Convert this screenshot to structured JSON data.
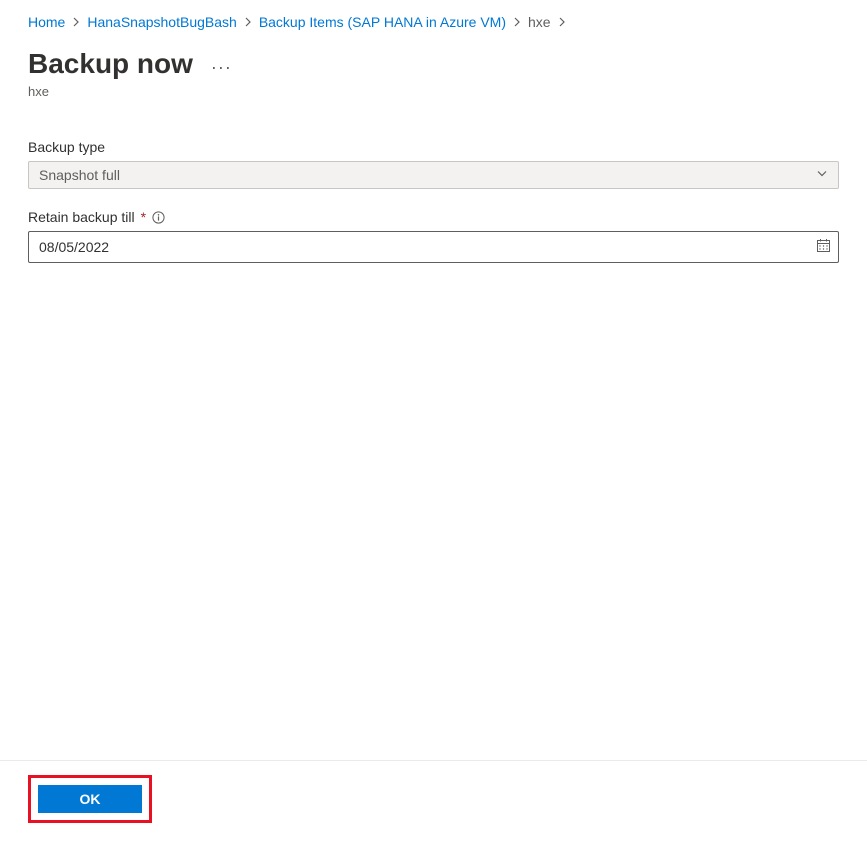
{
  "breadcrumb": {
    "home": "Home",
    "vault": "HanaSnapshotBugBash",
    "items": "Backup Items (SAP HANA in Azure VM)",
    "current": "hxe"
  },
  "header": {
    "title": "Backup now",
    "subtitle": "hxe"
  },
  "form": {
    "backup_type_label": "Backup type",
    "backup_type_value": "Snapshot full",
    "retain_label": "Retain backup till",
    "retain_value": "08/05/2022"
  },
  "footer": {
    "ok_label": "OK"
  }
}
